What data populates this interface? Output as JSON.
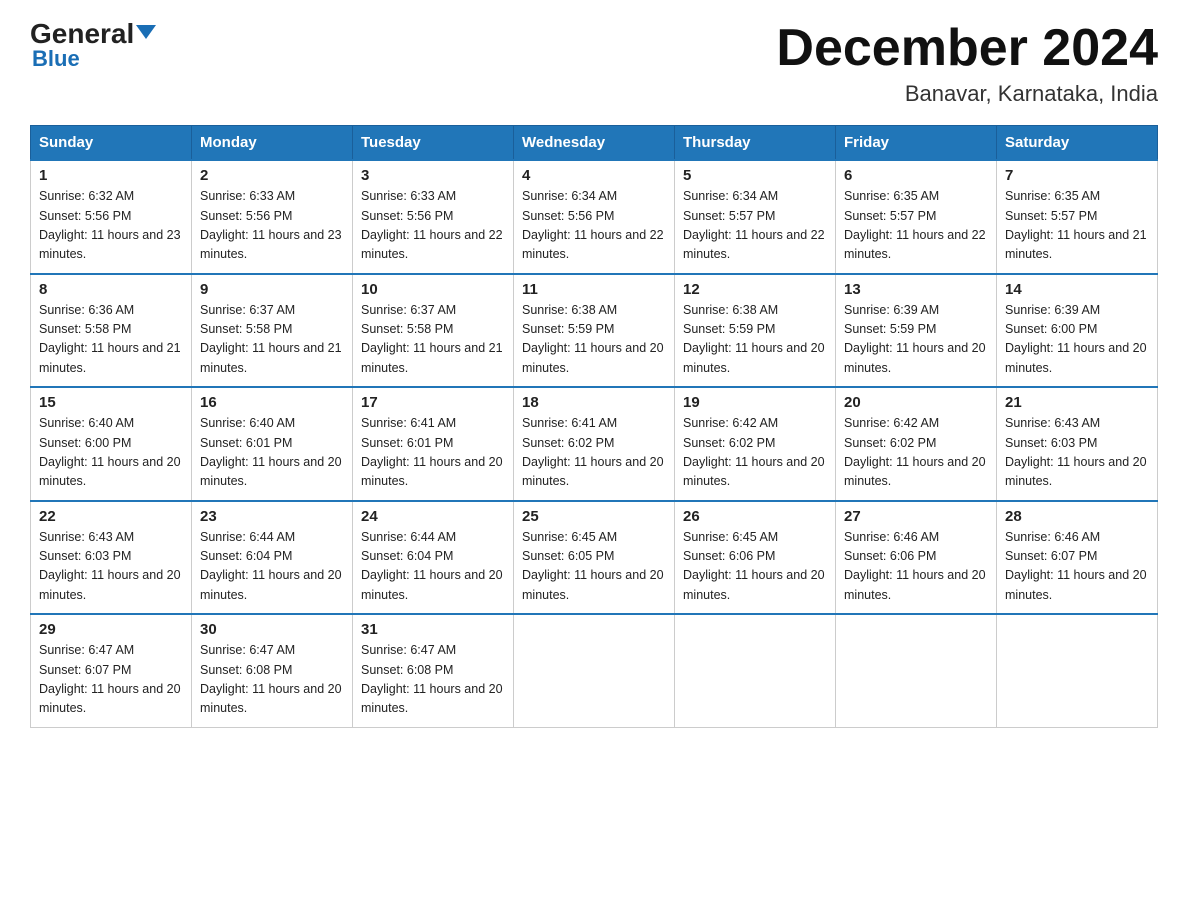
{
  "header": {
    "logo_general": "General",
    "logo_blue": "Blue",
    "month": "December 2024",
    "location": "Banavar, Karnataka, India"
  },
  "weekdays": [
    "Sunday",
    "Monday",
    "Tuesday",
    "Wednesday",
    "Thursday",
    "Friday",
    "Saturday"
  ],
  "weeks": [
    [
      {
        "day": 1,
        "sunrise": "6:32 AM",
        "sunset": "5:56 PM",
        "daylight": "11 hours and 23 minutes."
      },
      {
        "day": 2,
        "sunrise": "6:33 AM",
        "sunset": "5:56 PM",
        "daylight": "11 hours and 23 minutes."
      },
      {
        "day": 3,
        "sunrise": "6:33 AM",
        "sunset": "5:56 PM",
        "daylight": "11 hours and 22 minutes."
      },
      {
        "day": 4,
        "sunrise": "6:34 AM",
        "sunset": "5:56 PM",
        "daylight": "11 hours and 22 minutes."
      },
      {
        "day": 5,
        "sunrise": "6:34 AM",
        "sunset": "5:57 PM",
        "daylight": "11 hours and 22 minutes."
      },
      {
        "day": 6,
        "sunrise": "6:35 AM",
        "sunset": "5:57 PM",
        "daylight": "11 hours and 22 minutes."
      },
      {
        "day": 7,
        "sunrise": "6:35 AM",
        "sunset": "5:57 PM",
        "daylight": "11 hours and 21 minutes."
      }
    ],
    [
      {
        "day": 8,
        "sunrise": "6:36 AM",
        "sunset": "5:58 PM",
        "daylight": "11 hours and 21 minutes."
      },
      {
        "day": 9,
        "sunrise": "6:37 AM",
        "sunset": "5:58 PM",
        "daylight": "11 hours and 21 minutes."
      },
      {
        "day": 10,
        "sunrise": "6:37 AM",
        "sunset": "5:58 PM",
        "daylight": "11 hours and 21 minutes."
      },
      {
        "day": 11,
        "sunrise": "6:38 AM",
        "sunset": "5:59 PM",
        "daylight": "11 hours and 20 minutes."
      },
      {
        "day": 12,
        "sunrise": "6:38 AM",
        "sunset": "5:59 PM",
        "daylight": "11 hours and 20 minutes."
      },
      {
        "day": 13,
        "sunrise": "6:39 AM",
        "sunset": "5:59 PM",
        "daylight": "11 hours and 20 minutes."
      },
      {
        "day": 14,
        "sunrise": "6:39 AM",
        "sunset": "6:00 PM",
        "daylight": "11 hours and 20 minutes."
      }
    ],
    [
      {
        "day": 15,
        "sunrise": "6:40 AM",
        "sunset": "6:00 PM",
        "daylight": "11 hours and 20 minutes."
      },
      {
        "day": 16,
        "sunrise": "6:40 AM",
        "sunset": "6:01 PM",
        "daylight": "11 hours and 20 minutes."
      },
      {
        "day": 17,
        "sunrise": "6:41 AM",
        "sunset": "6:01 PM",
        "daylight": "11 hours and 20 minutes."
      },
      {
        "day": 18,
        "sunrise": "6:41 AM",
        "sunset": "6:02 PM",
        "daylight": "11 hours and 20 minutes."
      },
      {
        "day": 19,
        "sunrise": "6:42 AM",
        "sunset": "6:02 PM",
        "daylight": "11 hours and 20 minutes."
      },
      {
        "day": 20,
        "sunrise": "6:42 AM",
        "sunset": "6:02 PM",
        "daylight": "11 hours and 20 minutes."
      },
      {
        "day": 21,
        "sunrise": "6:43 AM",
        "sunset": "6:03 PM",
        "daylight": "11 hours and 20 minutes."
      }
    ],
    [
      {
        "day": 22,
        "sunrise": "6:43 AM",
        "sunset": "6:03 PM",
        "daylight": "11 hours and 20 minutes."
      },
      {
        "day": 23,
        "sunrise": "6:44 AM",
        "sunset": "6:04 PM",
        "daylight": "11 hours and 20 minutes."
      },
      {
        "day": 24,
        "sunrise": "6:44 AM",
        "sunset": "6:04 PM",
        "daylight": "11 hours and 20 minutes."
      },
      {
        "day": 25,
        "sunrise": "6:45 AM",
        "sunset": "6:05 PM",
        "daylight": "11 hours and 20 minutes."
      },
      {
        "day": 26,
        "sunrise": "6:45 AM",
        "sunset": "6:06 PM",
        "daylight": "11 hours and 20 minutes."
      },
      {
        "day": 27,
        "sunrise": "6:46 AM",
        "sunset": "6:06 PM",
        "daylight": "11 hours and 20 minutes."
      },
      {
        "day": 28,
        "sunrise": "6:46 AM",
        "sunset": "6:07 PM",
        "daylight": "11 hours and 20 minutes."
      }
    ],
    [
      {
        "day": 29,
        "sunrise": "6:47 AM",
        "sunset": "6:07 PM",
        "daylight": "11 hours and 20 minutes."
      },
      {
        "day": 30,
        "sunrise": "6:47 AM",
        "sunset": "6:08 PM",
        "daylight": "11 hours and 20 minutes."
      },
      {
        "day": 31,
        "sunrise": "6:47 AM",
        "sunset": "6:08 PM",
        "daylight": "11 hours and 20 minutes."
      },
      null,
      null,
      null,
      null
    ]
  ]
}
